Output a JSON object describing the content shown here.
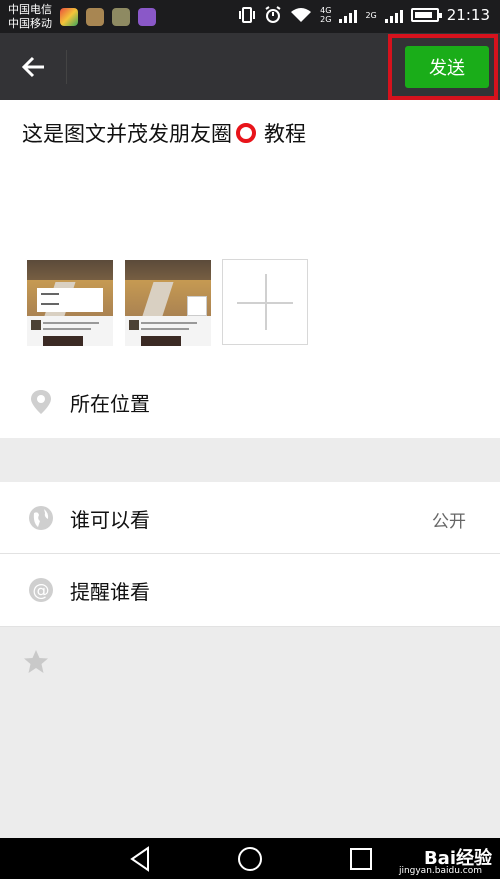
{
  "status_bar": {
    "carrier_1": "中国电信",
    "carrier_2": "中国移动",
    "net_1": "4G",
    "net_2": "2G",
    "net_3": "2G",
    "time": "21:13",
    "battery_percent": 85
  },
  "header": {
    "back_icon": "arrow-left-icon",
    "send_label": "发送",
    "send_color": "#1aad19",
    "highlight_color": "#d6121d"
  },
  "compose": {
    "text_before": "这是图文并茂发朋友圈",
    "text_after": "教程",
    "emoji": "red-circle-emoji",
    "add_photo_icon": "plus-icon"
  },
  "rows": {
    "location": {
      "label": "所在位置",
      "icon": "location-pin-icon"
    },
    "visibility": {
      "label": "谁可以看",
      "value": "公开",
      "icon": "globe-icon"
    },
    "mention": {
      "label": "提醒谁看",
      "icon": "at-icon"
    }
  },
  "footer": {
    "icon": "star-icon"
  },
  "watermark": {
    "brand": "Bai经验",
    "url": "jingyan.baidu.com"
  }
}
